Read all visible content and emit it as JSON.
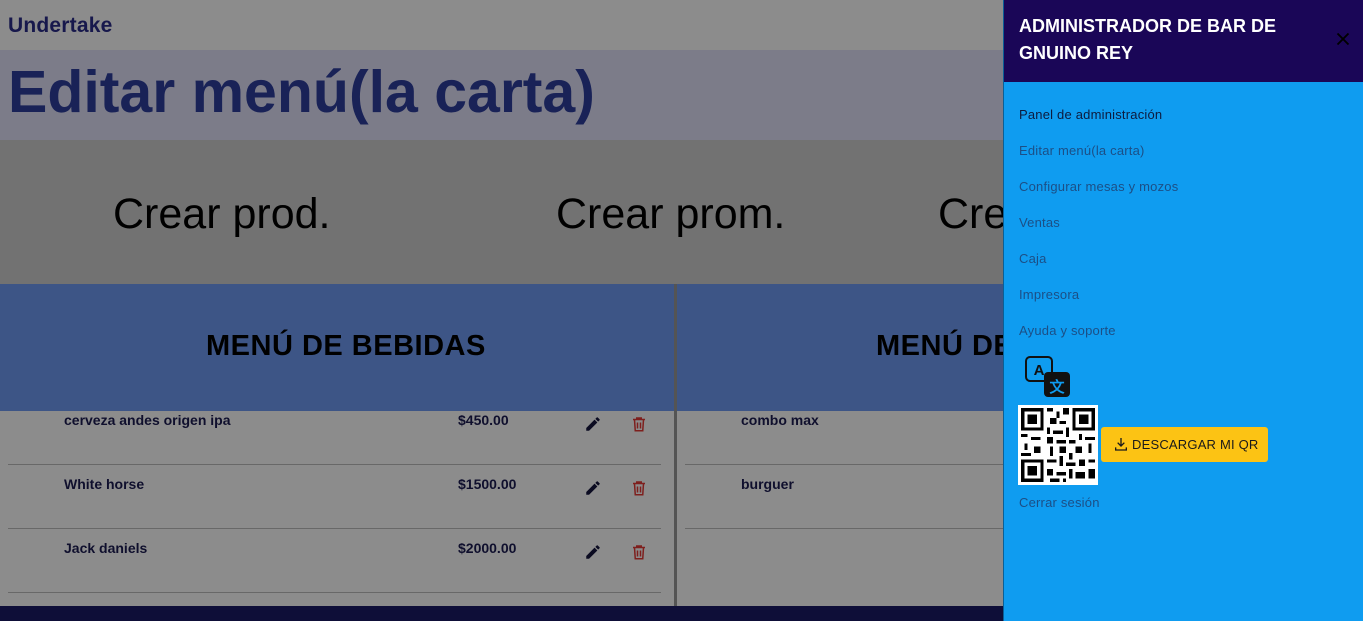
{
  "page": {
    "brand": "Undertake",
    "title": "Editar menú(la carta)",
    "actions": [
      "Crear prod.",
      "Crear prom.",
      "Cre"
    ],
    "columns": [
      {
        "title": "MENÚ DE BEBIDAS",
        "items": [
          {
            "name": "cerveza andes origen ipa",
            "price": "$450.00"
          },
          {
            "name": "White horse",
            "price": "$1500.00"
          },
          {
            "name": "Jack daniels",
            "price": "$2000.00"
          }
        ]
      },
      {
        "title": "MENÚ DE",
        "items": [
          {
            "name": "combo max"
          },
          {
            "name": "burguer"
          }
        ]
      }
    ]
  },
  "drawer": {
    "title": "ADMINISTRADOR DE BAR DE GNUINO REY",
    "menu": [
      "Panel de administración",
      "Editar menú(la carta)",
      "Configurar mesas y mozos",
      "Ventas",
      "Caja",
      "Impresora",
      "Ayuda y soporte"
    ],
    "download_label": "DESCARGAR MI QR",
    "logout": "Cerrar sesión"
  },
  "icons": {
    "edit": "pencil-icon",
    "delete": "trash-icon",
    "close": "close-icon",
    "translate": "translate-icon",
    "download": "download-icon"
  },
  "colors": {
    "drawer_bg": "#0f9cf0",
    "drawer_header": "#1a0657",
    "download_button": "#fcc314",
    "title_text": "#2e3f9e",
    "column_header": "#6f9bf5",
    "delete_icon": "#e53935"
  }
}
